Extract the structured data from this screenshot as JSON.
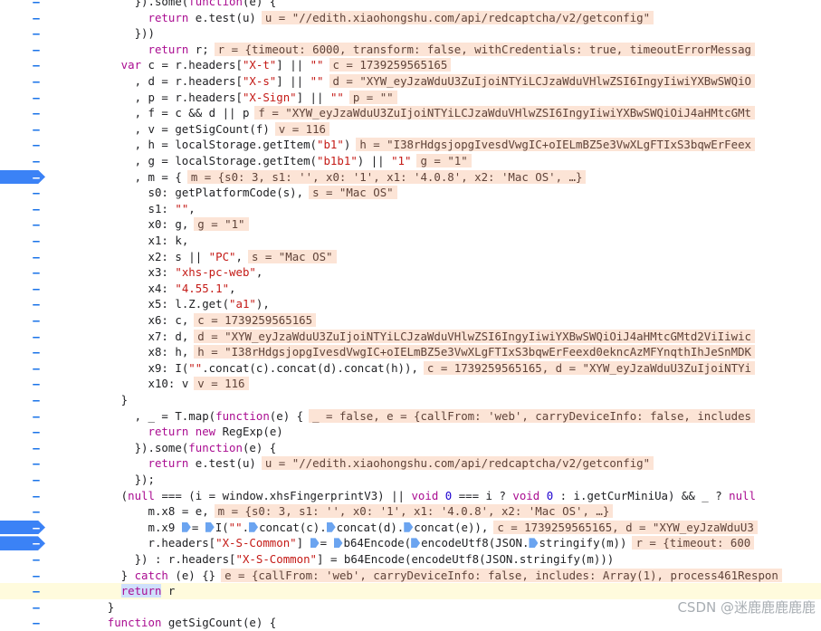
{
  "editor": {
    "watermark": "CSDN @迷鹿鹿鹿鹿鹿",
    "marker": "–",
    "lines": [
      {
        "indent": 10,
        "code": "}).some(function(e) {",
        "inline": "",
        "bp": false,
        "paused": false
      },
      {
        "indent": 12,
        "code": "return e.test(u)",
        "inline": "u = \"//edith.xiaohongshu.com/api/redcaptcha/v2/getconfig\"",
        "bp": false,
        "paused": false
      },
      {
        "indent": 10,
        "code": "}))",
        "inline": "",
        "bp": false,
        "paused": false
      },
      {
        "indent": 12,
        "code": "return r;",
        "inline": "r = {timeout: 6000, transform: false, withCredentials: true, timeoutErrorMessag",
        "bp": false,
        "paused": false
      },
      {
        "indent": 8,
        "code": "var c = r.headers[\"X-t\"] || \"\"",
        "inline": "c = 1739259565165",
        "bp": false,
        "paused": false
      },
      {
        "indent": 8,
        "code": "  , d = r.headers[\"X-s\"] || \"\"",
        "inline": "d = \"XYW_eyJzaWduU3ZuIjoiNTYiLCJzaWduVHlwZSI6IngyIiwiYXBwSWQiO",
        "bp": false,
        "paused": false
      },
      {
        "indent": 8,
        "code": "  , p = r.headers[\"X-Sign\"] || \"\"",
        "inline": "p = \"\"",
        "bp": false,
        "paused": false
      },
      {
        "indent": 8,
        "code": "  , f = c && d || p",
        "inline": "f = \"XYW_eyJzaWduU3ZuIjoiNTYiLCJzaWduVHlwZSI6IngyIiwiYXBwSWQiOiJ4aHMtcGMt",
        "bp": false,
        "paused": false
      },
      {
        "indent": 8,
        "code": "  , v = getSigCount(f)",
        "inline": "v = 116",
        "bp": false,
        "paused": false
      },
      {
        "indent": 8,
        "code": "  , h = localStorage.getItem(\"b1\")",
        "inline": "h = \"I38rHdgsjopgIvesdVwgIC+oIELmBZ5e3VwXLgFTIxS3bqwErFeex",
        "bp": false,
        "paused": false
      },
      {
        "indent": 8,
        "code": "  , g = localStorage.getItem(\"b1b1\") || \"1\"",
        "inline": "g = \"1\"",
        "bp": false,
        "paused": false
      },
      {
        "indent": 8,
        "code": "  , m = {",
        "inline": "m = {s0: 3, s1: '', x0: '1', x1: '4.0.8', x2: 'Mac OS', …}",
        "bp": true,
        "paused": false
      },
      {
        "indent": 12,
        "code": "s0: getPlatformCode(s),",
        "inline": "s = \"Mac OS\"",
        "bp": false,
        "paused": false
      },
      {
        "indent": 12,
        "code": "s1: \"\",",
        "inline": "",
        "bp": false,
        "paused": false
      },
      {
        "indent": 12,
        "code": "x0: g,",
        "inline": "g = \"1\"",
        "bp": false,
        "paused": false
      },
      {
        "indent": 12,
        "code": "x1: k,",
        "inline": "",
        "bp": false,
        "paused": false
      },
      {
        "indent": 12,
        "code": "x2: s || \"PC\",",
        "inline": "s = \"Mac OS\"",
        "bp": false,
        "paused": false
      },
      {
        "indent": 12,
        "code": "x3: \"xhs-pc-web\",",
        "inline": "",
        "bp": false,
        "paused": false
      },
      {
        "indent": 12,
        "code": "x4: \"4.55.1\",",
        "inline": "",
        "bp": false,
        "paused": false
      },
      {
        "indent": 12,
        "code": "x5: l.Z.get(\"a1\"),",
        "inline": "",
        "bp": false,
        "paused": false
      },
      {
        "indent": 12,
        "code": "x6: c,",
        "inline": "c = 1739259565165",
        "bp": false,
        "paused": false
      },
      {
        "indent": 12,
        "code": "x7: d,",
        "inline": "d = \"XYW_eyJzaWduU3ZuIjoiNTYiLCJzaWduVHlwZSI6IngyIiwiYXBwSWQiOiJ4aHMtcGMtd2ViIiwic",
        "bp": false,
        "paused": false
      },
      {
        "indent": 12,
        "code": "x8: h,",
        "inline": "h = \"I38rHdgsjopgIvesdVwgIC+oIELmBZ5e3VwXLgFTIxS3bqwErFeexd0ekncAzMFYnqthIhJeSnMDK",
        "bp": false,
        "paused": false
      },
      {
        "indent": 12,
        "code": "x9: I(\"\".concat(c).concat(d).concat(h)),",
        "inline": "c = 1739259565165, d = \"XYW_eyJzaWduU3ZuIjoiNTYi",
        "bp": false,
        "paused": false
      },
      {
        "indent": 12,
        "code": "x10: v",
        "inline": "v = 116",
        "bp": false,
        "paused": false
      },
      {
        "indent": 8,
        "code": "}",
        "inline": "",
        "bp": false,
        "paused": false
      },
      {
        "indent": 8,
        "code": "  , _ = T.map(function(e) {",
        "inline": "_ = false, e = {callFrom: 'web', carryDeviceInfo: false, includes",
        "bp": false,
        "paused": false
      },
      {
        "indent": 12,
        "code": "return new RegExp(e)",
        "inline": "",
        "bp": false,
        "paused": false
      },
      {
        "indent": 10,
        "code": "}).some(function(e) {",
        "inline": "",
        "bp": false,
        "paused": false
      },
      {
        "indent": 12,
        "code": "return e.test(u)",
        "inline": "u = \"//edith.xiaohongshu.com/api/redcaptcha/v2/getconfig\"",
        "bp": false,
        "paused": false
      },
      {
        "indent": 10,
        "code": "});",
        "inline": "",
        "bp": false,
        "paused": false
      },
      {
        "indent": 8,
        "code": "(null === (i = window.xhsFingerprintV3) || void 0 === i ? void 0 : i.getCurMiniUa) && _ ? null",
        "inline": "",
        "bp": false,
        "paused": false
      },
      {
        "indent": 12,
        "code": "m.x8 = e,",
        "inline": "m = {s0: 3, s1: '', x0: '1', x1: '4.0.8', x2: 'Mac OS', …}",
        "bp": false,
        "paused": false
      },
      {
        "indent": 12,
        "code": "m.x9 ▶= ▶I(\"\".▶concat(c).▶concat(d).▶concat(e)),",
        "inline": "c = 1739259565165, d = \"XYW_eyJzaWduU3",
        "bp": true,
        "paused": false
      },
      {
        "indent": 12,
        "code": "r.headers[\"X-S-Common\"] ▶= ▶b64Encode(▶encodeUtf8(JSON.▶stringify(m))",
        "inline": "r = {timeout: 600",
        "bp": true,
        "paused": false
      },
      {
        "indent": 10,
        "code": "}) : r.headers[\"X-S-Common\"] = b64Encode(encodeUtf8(JSON.stringify(m)))",
        "inline": "",
        "bp": false,
        "paused": false
      },
      {
        "indent": 8,
        "code": "} catch (e) {}",
        "inline": "e = {callFrom: 'web', carryDeviceInfo: false, includes: Array(1), process461Respon",
        "bp": false,
        "paused": false
      },
      {
        "indent": 8,
        "code": "return r",
        "inline": "",
        "bp": false,
        "paused": true
      },
      {
        "indent": 6,
        "code": "}",
        "inline": "",
        "bp": false,
        "paused": false
      },
      {
        "indent": 6,
        "code": "function getSigCount(e) {",
        "inline": "",
        "bp": false,
        "paused": false
      }
    ]
  }
}
